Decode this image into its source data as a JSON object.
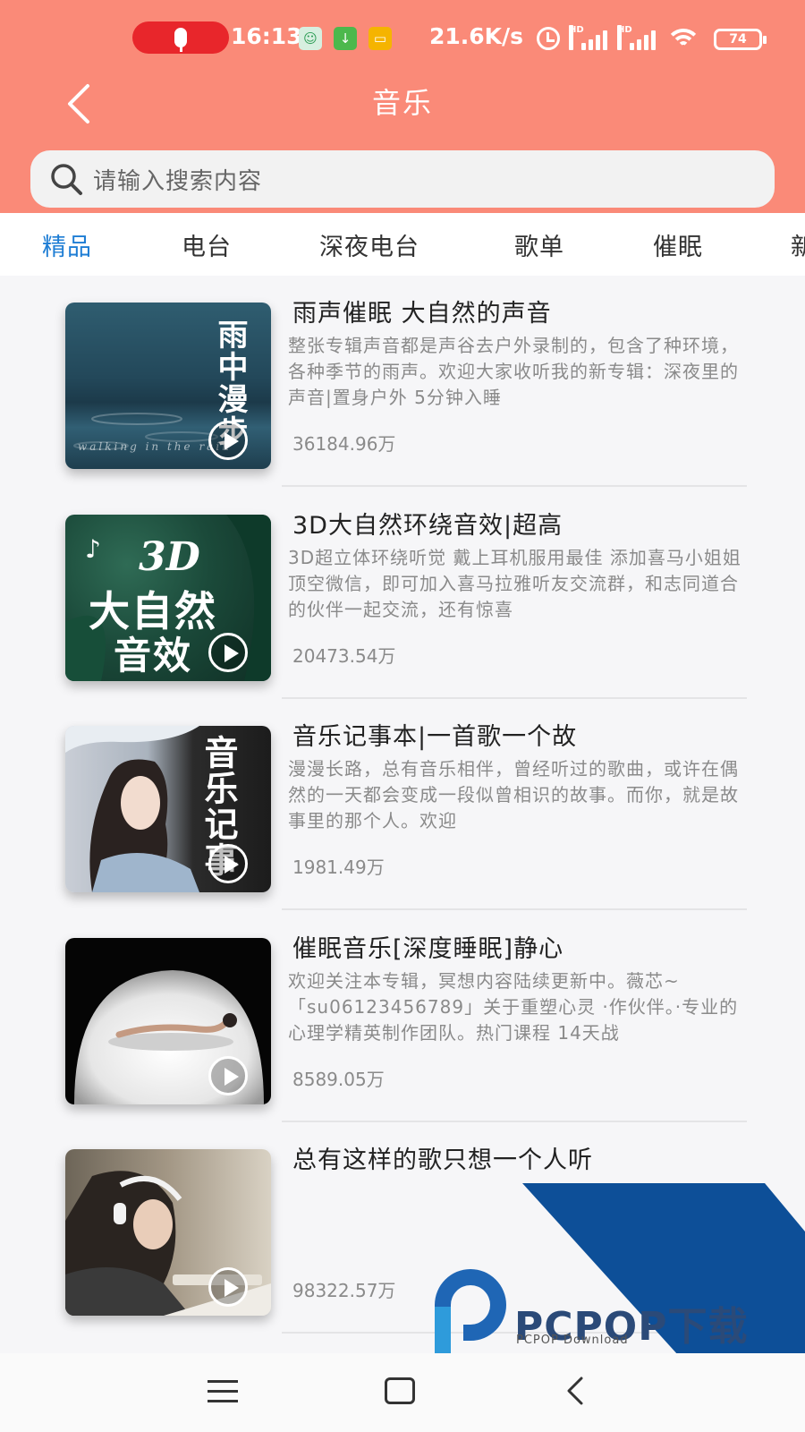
{
  "status_bar": {
    "time": "16:13",
    "net_speed": "21.6K/s",
    "battery": "74",
    "signal_label_1": "HD",
    "signal_label_2": "HD"
  },
  "header": {
    "title": "音乐",
    "search_placeholder": "请输入搜索内容"
  },
  "tabs": [
    {
      "label": "精品",
      "active": true
    },
    {
      "label": "电台",
      "active": false
    },
    {
      "label": "深夜电台",
      "active": false
    },
    {
      "label": "歌单",
      "active": false
    },
    {
      "label": "催眠",
      "active": false
    },
    {
      "label": "新",
      "active": false
    }
  ],
  "items": [
    {
      "title": "雨声催眠 大自然的声音",
      "description": "整张专辑声音都是声谷去户外录制的，包含了种环境，各种季节的雨声。欢迎大家收听我的新专辑：深夜里的声音|置身户外 5分钟入睡",
      "plays": "36184.96万",
      "cover_text": "雨中漫步",
      "cover_subtext": "walking in the rain"
    },
    {
      "title": "3D大自然环绕音效|超高",
      "description": "3D超立体环绕听觉 戴上耳机服用最佳 添加喜马小姐姐顶空微信，即可加入喜马拉雅听友交流群，和志同道合的伙伴一起交流，还有惊喜",
      "plays": "20473.54万",
      "cover_text_1": "3D",
      "cover_text_2": "大自然",
      "cover_text_3": "音效"
    },
    {
      "title": "音乐记事本|一首歌一个故",
      "description": "漫漫长路，总有音乐相伴，曾经听过的歌曲，或许在偶然的一天都会变成一段似曾相识的故事。而你，就是故事里的那个人。欢迎",
      "plays": "1981.49万",
      "cover_text": "音乐记事"
    },
    {
      "title": "催眠音乐[深度睡眠]静心",
      "description": "欢迎关注本专辑，冥想内容陆续更新中。薇芯~「su06123456789」关于重塑心灵 ·作伙伴。·专业的心理学精英制作团队。热门课程 14天战",
      "plays": "8589.05万"
    },
    {
      "title": "总有这样的歌只想一个人听",
      "description": "",
      "plays": "98322.57万"
    }
  ],
  "watermark": {
    "brand": "PCPOP下载",
    "sub": "PCPOP Download"
  },
  "colors": {
    "header_bg": "#fa8a78",
    "tab_active": "#1e7dd4",
    "watermark_blue": "#0d4f98"
  },
  "icons": [
    "mic-icon",
    "back-arrow-icon",
    "search-icon",
    "play-icon",
    "menu-icon",
    "home-icon",
    "nav-back-icon",
    "wifi-icon",
    "alarm-icon",
    "battery-icon"
  ]
}
